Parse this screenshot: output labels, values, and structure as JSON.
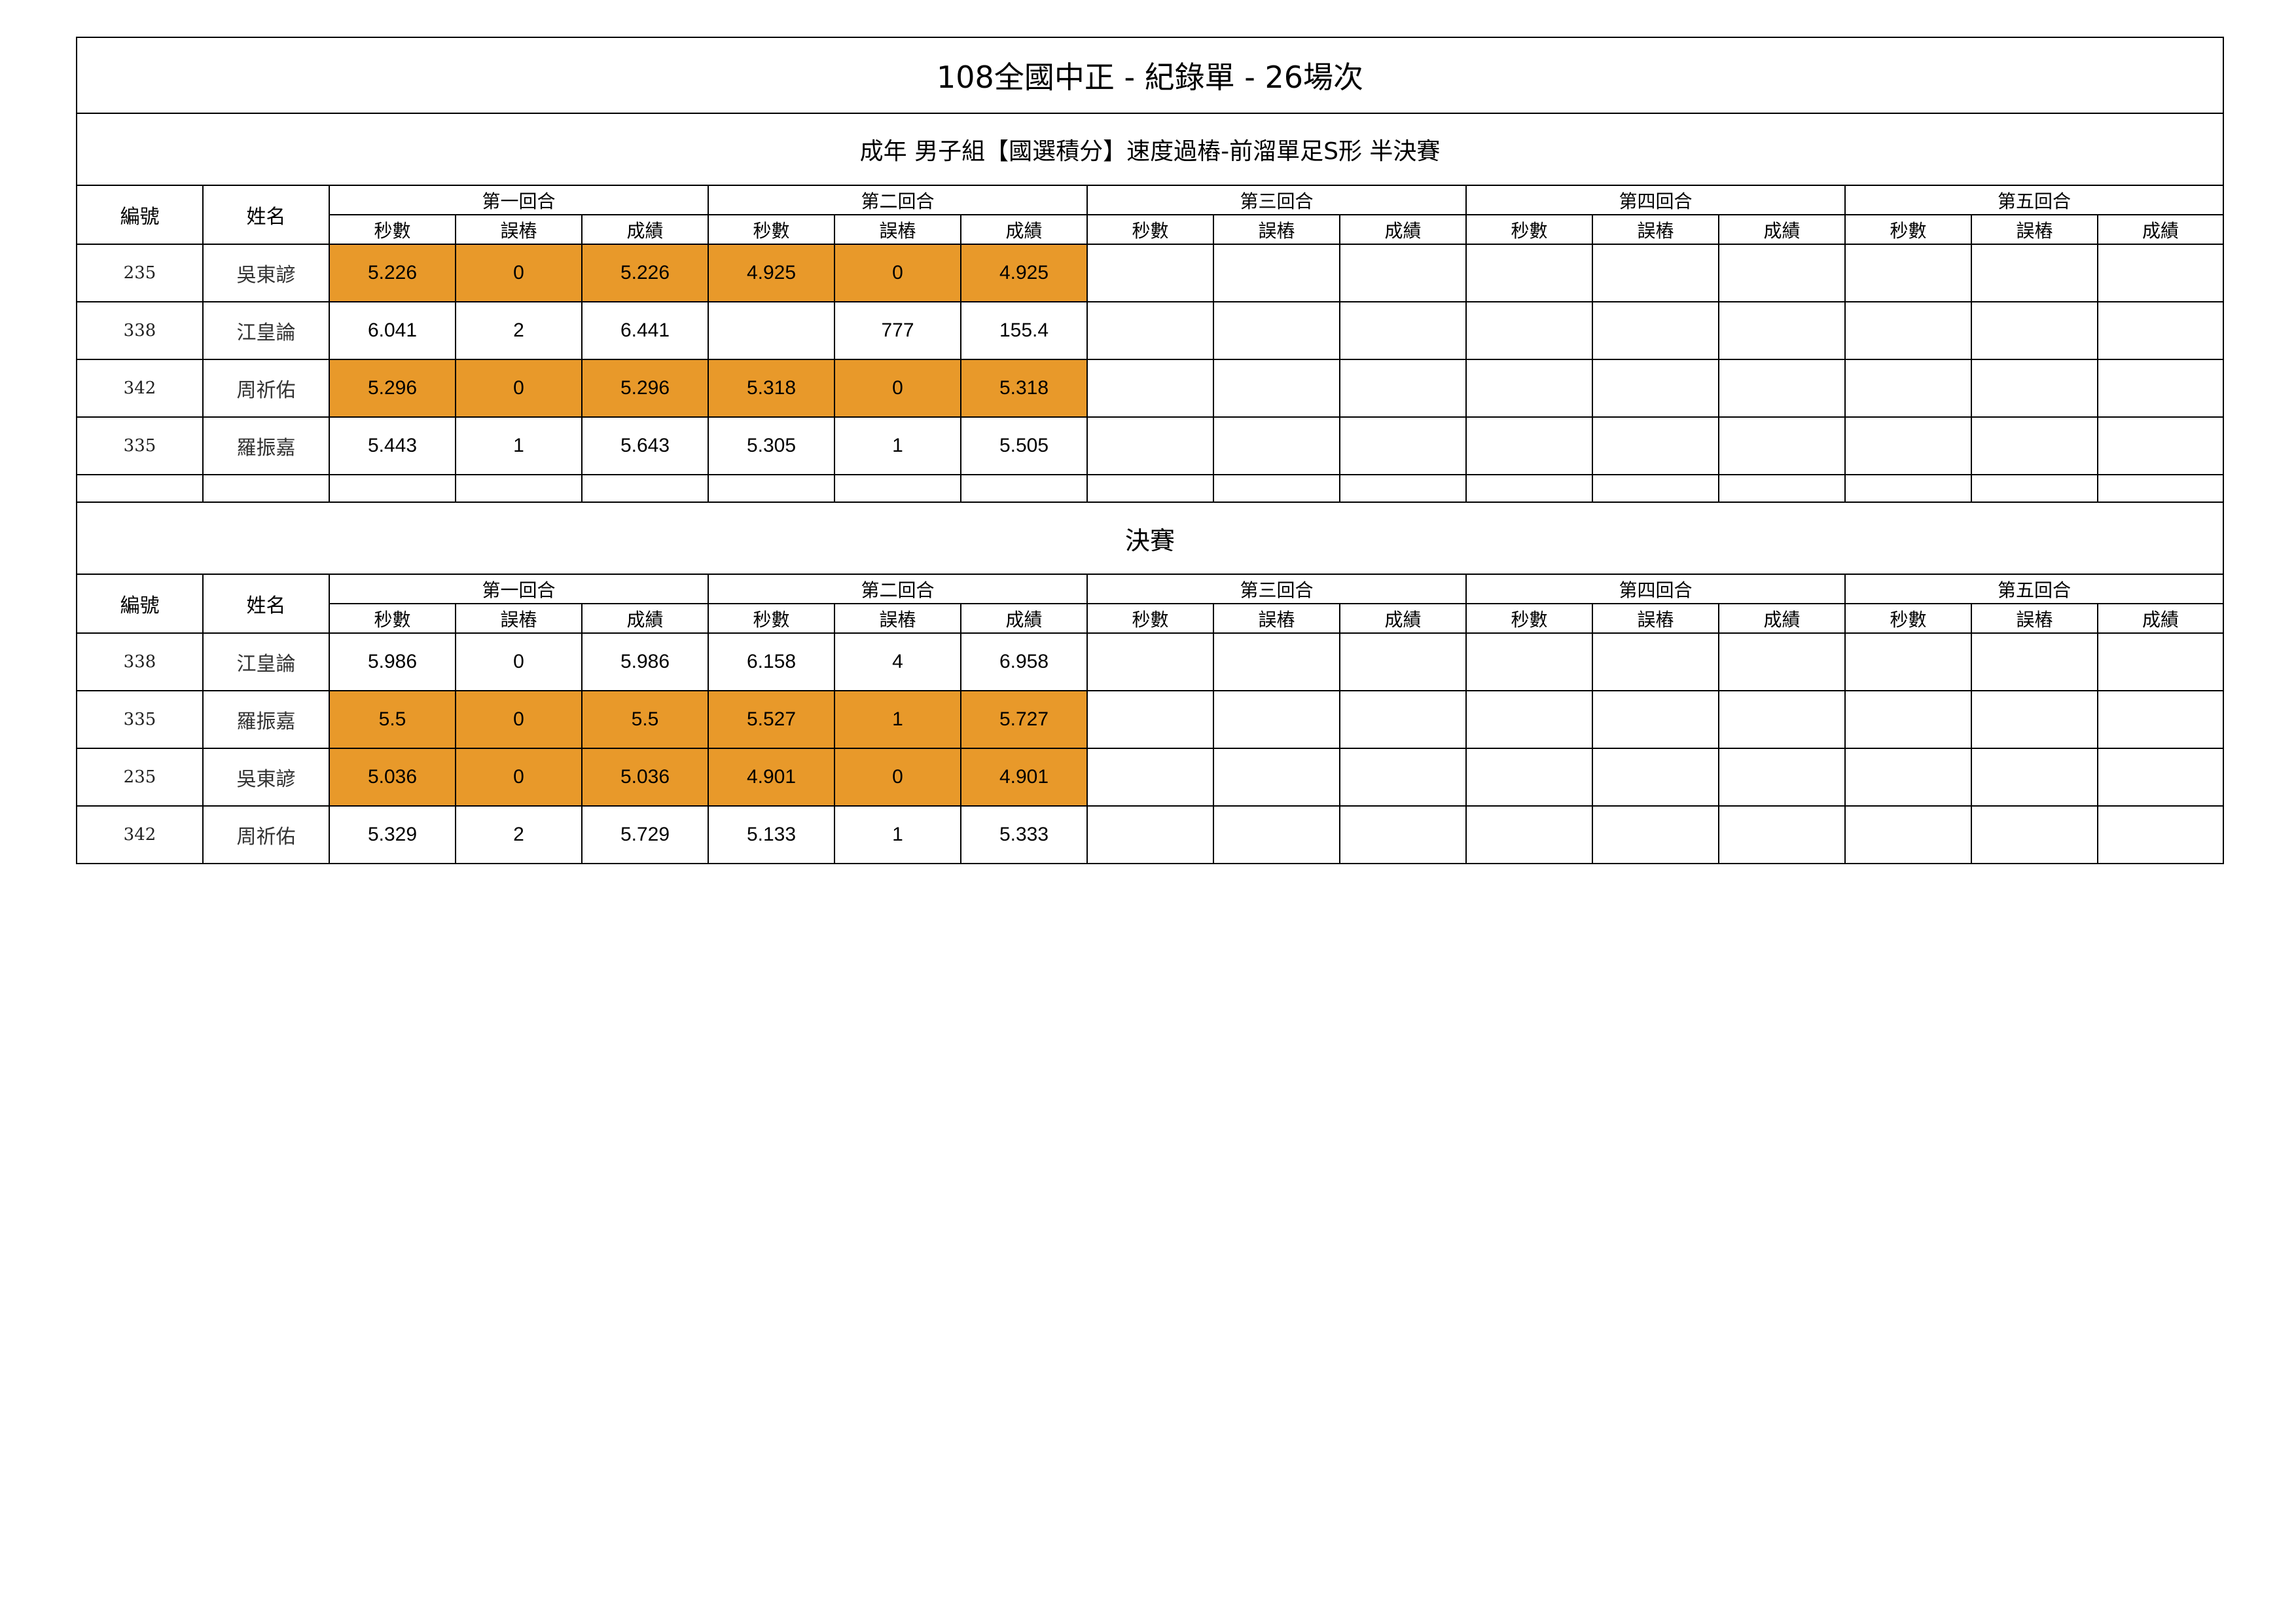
{
  "title": "108全國中正 - 紀錄單 - 26場次",
  "header_labels": {
    "id": "編號",
    "name": "姓名",
    "rounds": [
      "第一回合",
      "第二回合",
      "第三回合",
      "第四回合",
      "第五回合"
    ],
    "sub": [
      "秒數",
      "誤樁",
      "成績"
    ]
  },
  "colors": {
    "highlight": "#e8992a",
    "border": "#000000"
  },
  "semifinal": {
    "title": "成年 男子組【國選積分】速度過樁-前溜單足S形 半決賽",
    "rows": [
      {
        "id": "235",
        "name": "吳東諺",
        "highlight": true,
        "values": [
          "5.226",
          "0",
          "5.226",
          "4.925",
          "0",
          "4.925",
          "",
          "",
          "",
          "",
          "",
          "",
          "",
          "",
          ""
        ]
      },
      {
        "id": "338",
        "name": "江皇論",
        "highlight": false,
        "values": [
          "6.041",
          "2",
          "6.441",
          "",
          "777",
          "155.4",
          "",
          "",
          "",
          "",
          "",
          "",
          "",
          "",
          ""
        ]
      },
      {
        "id": "342",
        "name": "周祈佑",
        "highlight": true,
        "values": [
          "5.296",
          "0",
          "5.296",
          "5.318",
          "0",
          "5.318",
          "",
          "",
          "",
          "",
          "",
          "",
          "",
          "",
          ""
        ]
      },
      {
        "id": "335",
        "name": "羅振嘉",
        "highlight": false,
        "values": [
          "5.443",
          "1",
          "5.643",
          "5.305",
          "1",
          "5.505",
          "",
          "",
          "",
          "",
          "",
          "",
          "",
          "",
          ""
        ]
      }
    ]
  },
  "final": {
    "title": "決賽",
    "rows": [
      {
        "id": "338",
        "name": "江皇論",
        "highlight": false,
        "values": [
          "5.986",
          "0",
          "5.986",
          "6.158",
          "4",
          "6.958",
          "",
          "",
          "",
          "",
          "",
          "",
          "",
          "",
          ""
        ]
      },
      {
        "id": "335",
        "name": "羅振嘉",
        "highlight": true,
        "values": [
          "5.5",
          "0",
          "5.5",
          "5.527",
          "1",
          "5.727",
          "",
          "",
          "",
          "",
          "",
          "",
          "",
          "",
          ""
        ]
      },
      {
        "id": "235",
        "name": "吳東諺",
        "highlight": true,
        "values": [
          "5.036",
          "0",
          "5.036",
          "4.901",
          "0",
          "4.901",
          "",
          "",
          "",
          "",
          "",
          "",
          "",
          "",
          ""
        ]
      },
      {
        "id": "342",
        "name": "周祈佑",
        "highlight": false,
        "values": [
          "5.329",
          "2",
          "5.729",
          "5.133",
          "1",
          "5.333",
          "",
          "",
          "",
          "",
          "",
          "",
          "",
          "",
          ""
        ]
      }
    ]
  }
}
